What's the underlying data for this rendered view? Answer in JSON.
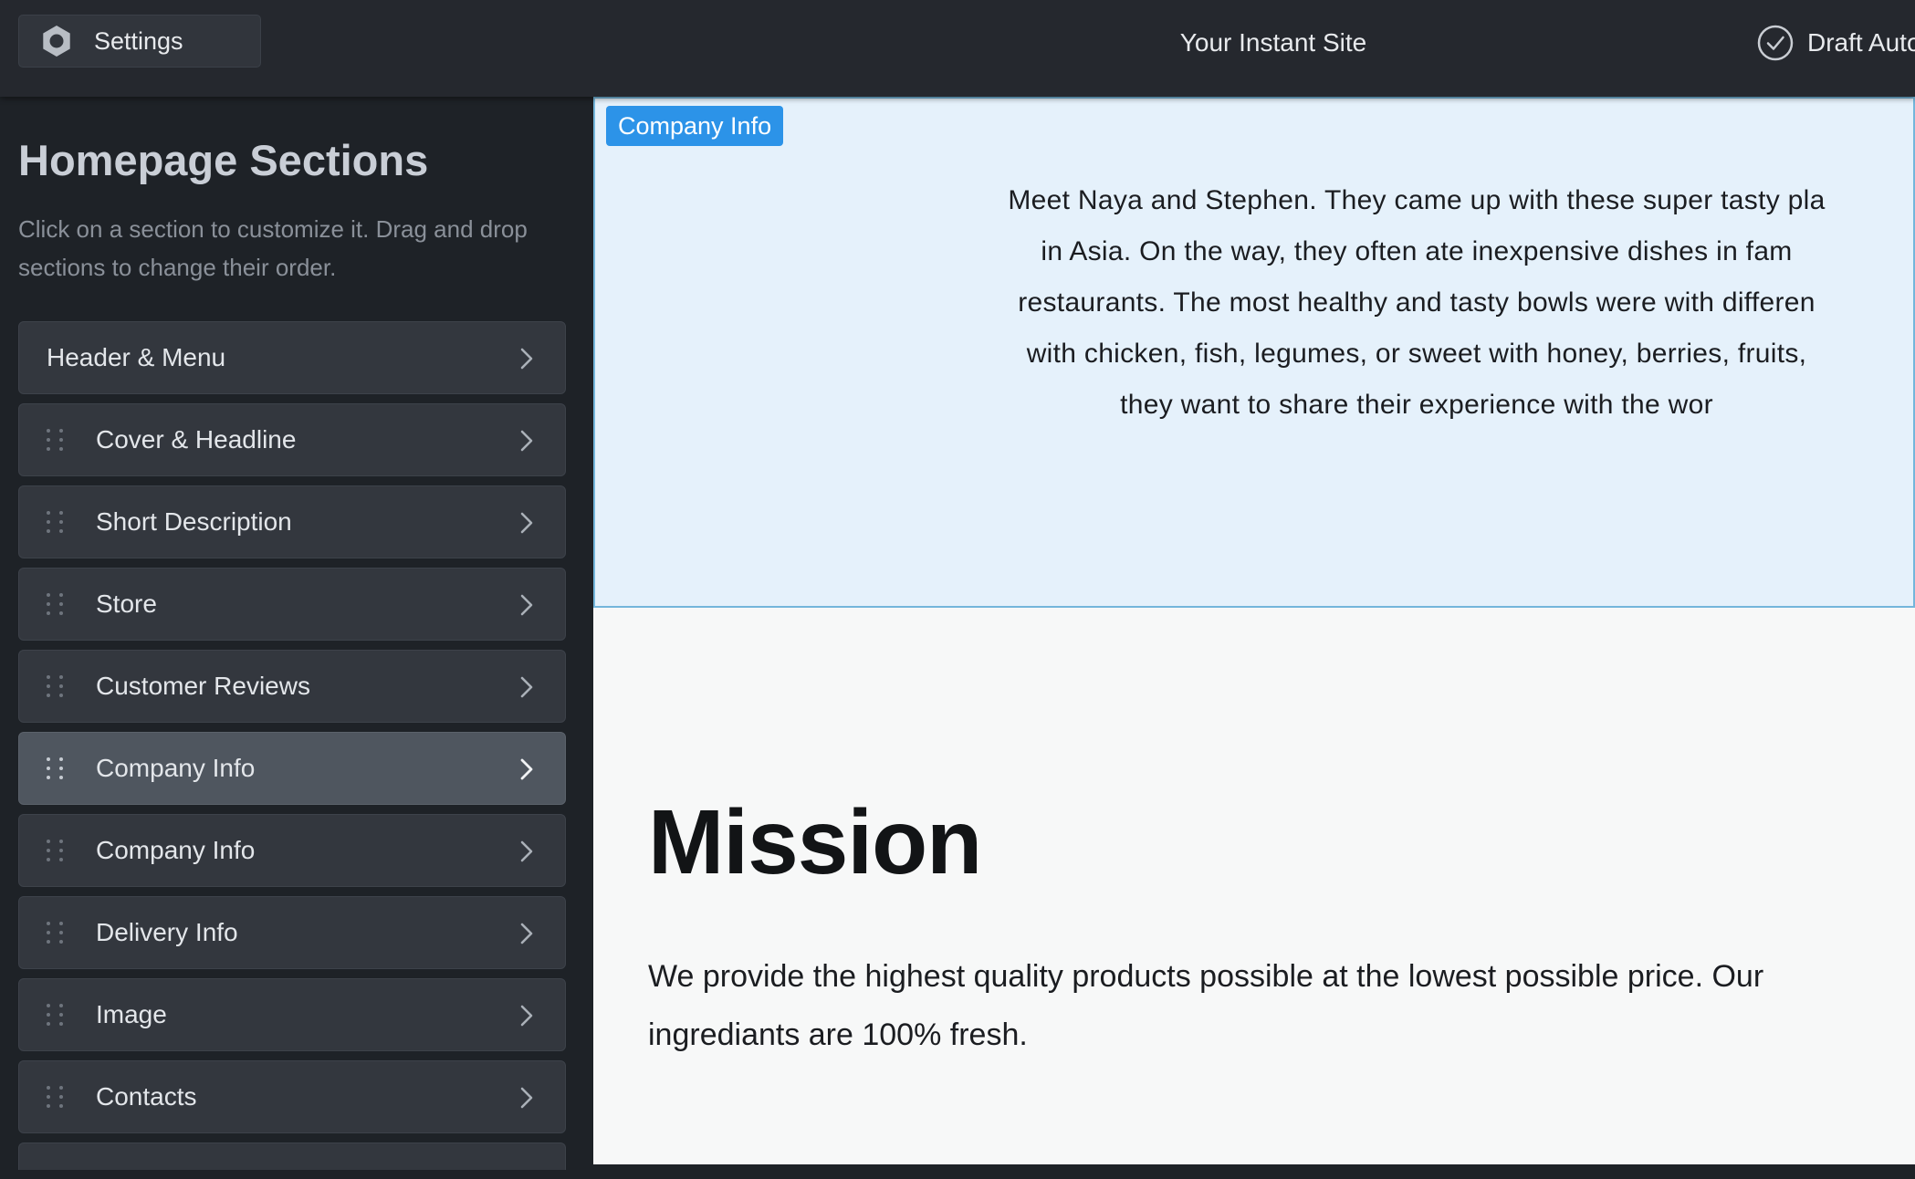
{
  "topbar": {
    "settings_label": "Settings",
    "settings_icon": "gear-icon",
    "site_title": "Your Instant Site",
    "draft_status": "Draft Auto",
    "draft_icon": "check-circle-icon"
  },
  "sidebar": {
    "title": "Homepage Sections",
    "description": "Click on a section to customize it. Drag and drop sections to change their order.",
    "items": [
      {
        "label": "Header & Menu",
        "draggable": false,
        "active": false
      },
      {
        "label": "Cover & Headline",
        "draggable": true,
        "active": false
      },
      {
        "label": "Short Description",
        "draggable": true,
        "active": false
      },
      {
        "label": "Store",
        "draggable": true,
        "active": false
      },
      {
        "label": "Customer Reviews",
        "draggable": true,
        "active": false
      },
      {
        "label": "Company Info",
        "draggable": true,
        "active": true
      },
      {
        "label": "Company Info",
        "draggable": true,
        "active": false
      },
      {
        "label": "Delivery Info",
        "draggable": true,
        "active": false
      },
      {
        "label": "Image",
        "draggable": true,
        "active": false
      },
      {
        "label": "Contacts",
        "draggable": true,
        "active": false
      }
    ]
  },
  "preview": {
    "selected_section_tag": "Company Info",
    "company_text": "Meet Naya and Stephen. They came up with these super tasty pla in Asia. On the way, they often ate inexpensive dishes in fam restaurants. The most healthy and tasty bowls were with differen with chicken, fish, legumes, or sweet with honey, berries, fruits, they want to share their experience with the wor",
    "company_lines": [
      "Meet Naya and Stephen. They came up with these super tasty pla",
      "in Asia. On the way, they often ate inexpensive dishes in fam",
      "restaurants. The most healthy and tasty bowls were with differen",
      "with chicken, fish, legumes, or sweet with honey, berries, fruits,",
      "they want to share their experience with the wor"
    ],
    "mission_title": "Mission",
    "mission_text": "We provide the highest quality products possible at the lowest possible price. Our ingrediants are 100% fresh."
  },
  "colors": {
    "topbar_bg": "#25282e",
    "sidebar_bg": "#1e2227",
    "item_bg": "#33373e",
    "item_active_bg": "#4f565f",
    "tag_bg": "#2c93e8",
    "selected_section_bg": "#e5f1fb",
    "selected_section_border": "#74b6db"
  }
}
